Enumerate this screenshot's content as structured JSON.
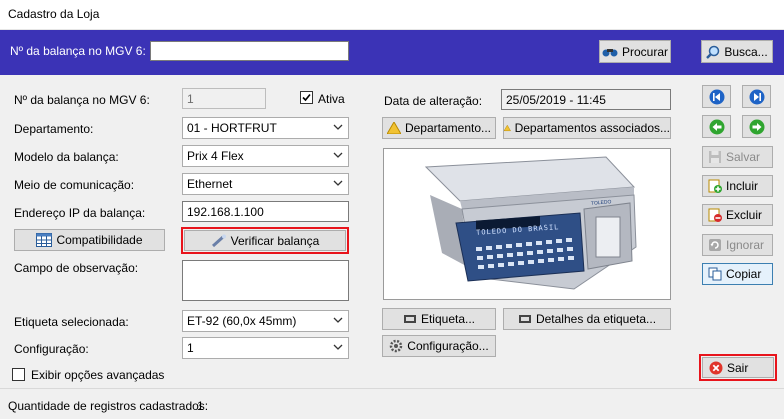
{
  "window": {
    "title": "Cadastro da Loja"
  },
  "topbar": {
    "scale_label": "Nº da balança no MGV 6:",
    "scale_value": "",
    "procurar_label": "Procurar",
    "busca_label": "Busca..."
  },
  "form": {
    "scale_number_label": "Nº da balança no MGV 6:",
    "scale_number_value": "1",
    "ativa_label": "Ativa",
    "ativa_checked": true,
    "department_label": "Departamento:",
    "department_value": "01 - HORTFRUT",
    "model_label": "Modelo da balança:",
    "model_value": "Prix 4 Flex",
    "comm_label": "Meio de comunicação:",
    "comm_value": "Ethernet",
    "ip_label": "Endereço IP da balança:",
    "ip_value": "192.168.1.100",
    "compat_label": "Compatibilidade",
    "verify_label": "Verificar balança",
    "obs_label": "Campo de observação:",
    "obs_value": "",
    "label_sel_label": "Etiqueta selecionada:",
    "label_sel_value": "ET-92 (60,0x  45mm)",
    "config_label": "Configuração:",
    "config_value": "1",
    "advanced_label": "Exibir opções avançadas",
    "advanced_checked": false
  },
  "right": {
    "date_label": "Data de alteração:",
    "date_value": "25/05/2019 - 11:45",
    "dept_btn": "Departamento...",
    "dept_assoc_btn": "Departamentos associados...",
    "etiqueta_btn": "Etiqueta...",
    "details_btn": "Detalhes da etiqueta...",
    "config_btn": "Configuração...",
    "scale_display_text": "TOLEDO DO BRASIL",
    "scale_brand_text": "TOLEDO"
  },
  "actions": {
    "salvar": "Salvar",
    "incluir": "Incluir",
    "excluir": "Excluir",
    "ignorar": "Ignorar",
    "copiar": "Copiar",
    "sair": "Sair"
  },
  "status": {
    "count_label": "Quantidade de registros cadastrados:",
    "count_value": "1"
  },
  "colors": {
    "topbar": "#3b33b6",
    "highlight": "#e8141c"
  }
}
